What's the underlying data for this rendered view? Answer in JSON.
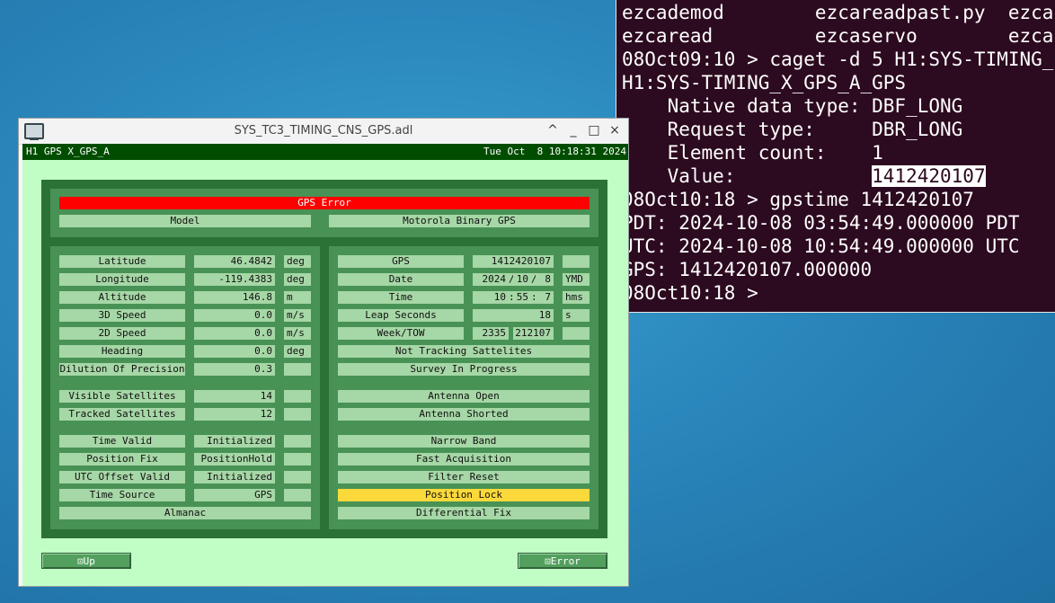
{
  "terminal": {
    "lines": [
      "ezcademod        ezcareadpast.py  ezca",
      "ezcaread         ezcaservo        ezca",
      "08Oct09:10 > caget -d 5 H1:SYS-TIMING_",
      "H1:SYS-TIMING_X_GPS_A_GPS",
      "    Native data type: DBF_LONG",
      "    Request type:     DBR_LONG",
      "    Element count:    1",
      "08Oct10:18 > gpstime 1412420107",
      "PDT: 2024-10-08 03:54:49.000000 PDT",
      "UTC: 2024-10-08 10:54:49.000000 UTC",
      "GPS: 1412420107.000000",
      "08Oct10:18 > "
    ],
    "value_label": "    Value:            ",
    "value": "1412420107"
  },
  "window": {
    "title": "SYS_TC3_TIMING_CNS_GPS.adl",
    "controls": [
      "^",
      "_",
      "□",
      "×"
    ]
  },
  "header": {
    "left": "H1 GPS X_GPS_A",
    "right": "Tue Oct  8 10:18:31 2024"
  },
  "status": {
    "error": "GPS Error",
    "model_label": "Model",
    "model_value": "Motorola Binary GPS"
  },
  "left_rows": [
    {
      "label": "Latitude",
      "value": "46.4842",
      "unit": "deg"
    },
    {
      "label": "Longitude",
      "value": "-119.4383",
      "unit": "deg"
    },
    {
      "label": "Altitude",
      "value": "146.8",
      "unit": "m"
    },
    {
      "label": "3D Speed",
      "value": "0.0",
      "unit": "m/s"
    },
    {
      "label": "2D Speed",
      "value": "0.0",
      "unit": "m/s"
    },
    {
      "label": "Heading",
      "value": "0.0",
      "unit": "deg"
    },
    {
      "label": "Dilution Of Precision",
      "value": "0.3",
      "unit": ""
    },
    {
      "label": "Visible Satellites",
      "value": "14",
      "unit": ""
    },
    {
      "label": "Tracked Satellites",
      "value": "12",
      "unit": ""
    },
    {
      "label": "Time Valid",
      "value": "Initialized",
      "unit": ""
    },
    {
      "label": "Position Fix",
      "value": "PositionHold",
      "unit": ""
    },
    {
      "label": "UTC Offset Valid",
      "value": "Initialized",
      "unit": ""
    },
    {
      "label": "Time Source",
      "value": "GPS",
      "unit": ""
    }
  ],
  "almanac": "Almanac",
  "right_top": {
    "gps": {
      "label": "GPS",
      "value": "1412420107",
      "unit": ""
    },
    "date": {
      "label": "Date",
      "y": "2024",
      "m": "10",
      "d": "8",
      "unit": "YMD"
    },
    "time": {
      "label": "Time",
      "h": "10",
      "min": "55",
      "s": "7",
      "unit": "hms"
    },
    "leap": {
      "label": "Leap Seconds",
      "value": "18",
      "unit": "s"
    },
    "week": {
      "label": "Week/TOW",
      "week": "2335",
      "tow": "212107",
      "unit": ""
    }
  },
  "right_flags": [
    "Not Tracking Sattelites",
    "Survey In Progress",
    "Antenna Open",
    "Antenna Shorted",
    "Narrow Band",
    "Fast Acquisition",
    "Filter Reset",
    "Position Lock",
    "Differential Fix"
  ],
  "buttons": {
    "up": "⊡Up",
    "error": "⊡Error"
  }
}
